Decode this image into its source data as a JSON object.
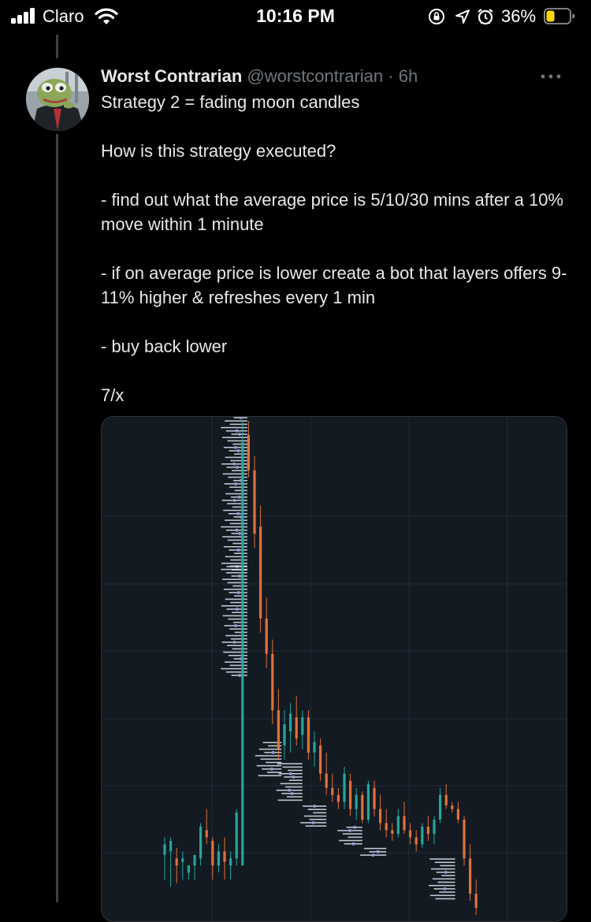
{
  "status_bar": {
    "carrier": "Claro",
    "time": "10:16 PM",
    "battery_percent": "36%",
    "battery_level": 0.36,
    "battery_color": "#ffd60a",
    "icons": [
      "signal-icon",
      "wifi-icon",
      "orientation-lock-icon",
      "location-icon",
      "alarm-icon",
      "battery-icon"
    ]
  },
  "tweet": {
    "author_name": "Worst Contrarian",
    "handle": "@worstcontrarian",
    "separator": "·",
    "time": "6h",
    "avatar_icon": "frog-avatar",
    "more_icon": "more-icon",
    "lines": [
      "Strategy 2 = fading moon candles",
      "How is this strategy executed?",
      "- find out what the average price is 5/10/30 mins after a 10% move within 1 minute",
      "- if on average price is lower create a bot that layers offers 9-11% higher & refreshes every 1 min",
      "- buy back lower",
      "7/x"
    ]
  },
  "chart_data": {
    "type": "candlestick",
    "background": "#131a22",
    "grid": true,
    "up_color": "#26a69a",
    "down_color": "#e0713c",
    "candles": [
      {
        "o": 41.5,
        "h": 44,
        "l": 38,
        "c": 43
      },
      {
        "o": 42,
        "h": 44,
        "l": 37,
        "c": 43.5
      },
      {
        "o": 41,
        "h": 42.5,
        "l": 37.5,
        "c": 40
      },
      {
        "o": 40.5,
        "h": 42,
        "l": 38,
        "c": 41
      },
      {
        "o": 39,
        "h": 40,
        "l": 38,
        "c": 40
      },
      {
        "o": 40,
        "h": 41,
        "l": 38,
        "c": 41.5
      },
      {
        "o": 41,
        "h": 46,
        "l": 40,
        "c": 45.5
      },
      {
        "o": 45,
        "h": 48,
        "l": 43,
        "c": 44
      },
      {
        "o": 43.5,
        "h": 44,
        "l": 38,
        "c": 40
      },
      {
        "o": 40,
        "h": 43,
        "l": 39,
        "c": 42
      },
      {
        "o": 42,
        "h": 44,
        "l": 38,
        "c": 40.5
      },
      {
        "o": 40,
        "h": 42,
        "l": 38,
        "c": 41
      },
      {
        "o": 41,
        "h": 48,
        "l": 40,
        "c": 47.5
      },
      {
        "o": 40,
        "h": 103,
        "l": 40,
        "c": 100
      },
      {
        "o": 101,
        "h": 103,
        "l": 95,
        "c": 96
      },
      {
        "o": 96,
        "h": 98,
        "l": 85,
        "c": 87
      },
      {
        "o": 88,
        "h": 91,
        "l": 73,
        "c": 75
      },
      {
        "o": 75,
        "h": 78,
        "l": 68,
        "c": 70
      },
      {
        "o": 70,
        "h": 72,
        "l": 60,
        "c": 62
      },
      {
        "o": 62,
        "h": 65,
        "l": 55,
        "c": 56.5
      },
      {
        "o": 57,
        "h": 62,
        "l": 55,
        "c": 60
      },
      {
        "o": 59,
        "h": 63,
        "l": 56,
        "c": 61.5
      },
      {
        "o": 61,
        "h": 64,
        "l": 57,
        "c": 58
      },
      {
        "o": 58.5,
        "h": 62,
        "l": 56.5,
        "c": 61
      },
      {
        "o": 61,
        "h": 62,
        "l": 55,
        "c": 56
      },
      {
        "o": 56,
        "h": 59,
        "l": 54,
        "c": 57.5
      },
      {
        "o": 57,
        "h": 58,
        "l": 52,
        "c": 53
      },
      {
        "o": 53,
        "h": 56,
        "l": 50,
        "c": 51
      },
      {
        "o": 51,
        "h": 53,
        "l": 49,
        "c": 50
      },
      {
        "o": 50,
        "h": 51,
        "l": 48,
        "c": 49
      },
      {
        "o": 49,
        "h": 54,
        "l": 48,
        "c": 53
      },
      {
        "o": 52,
        "h": 53,
        "l": 47,
        "c": 48
      },
      {
        "o": 48,
        "h": 51,
        "l": 46.5,
        "c": 50
      },
      {
        "o": 50,
        "h": 50.5,
        "l": 46,
        "c": 46.5
      },
      {
        "o": 46.5,
        "h": 52,
        "l": 46,
        "c": 51.5
      },
      {
        "o": 51,
        "h": 52,
        "l": 47,
        "c": 48
      },
      {
        "o": 48,
        "h": 50,
        "l": 45,
        "c": 46
      },
      {
        "o": 46,
        "h": 48,
        "l": 44,
        "c": 45
      },
      {
        "o": 45,
        "h": 46,
        "l": 43.5,
        "c": 44.5
      },
      {
        "o": 44.5,
        "h": 48,
        "l": 44,
        "c": 47
      },
      {
        "o": 47,
        "h": 49,
        "l": 44.5,
        "c": 45
      },
      {
        "o": 45,
        "h": 46,
        "l": 43,
        "c": 44
      },
      {
        "o": 44,
        "h": 45,
        "l": 42,
        "c": 43
      },
      {
        "o": 43,
        "h": 46,
        "l": 42.5,
        "c": 45.5
      },
      {
        "o": 45.5,
        "h": 47,
        "l": 43.5,
        "c": 44.5
      },
      {
        "o": 44.5,
        "h": 47,
        "l": 43,
        "c": 46.5
      },
      {
        "o": 46.5,
        "h": 51,
        "l": 46,
        "c": 50
      },
      {
        "o": 50,
        "h": 51.5,
        "l": 48,
        "c": 48.5
      },
      {
        "o": 48.5,
        "h": 49,
        "l": 47.5,
        "c": 48
      },
      {
        "o": 48,
        "h": 49,
        "l": 46,
        "c": 46.5
      },
      {
        "o": 46.5,
        "h": 47,
        "l": 40,
        "c": 41
      },
      {
        "o": 41,
        "h": 43,
        "l": 35,
        "c": 36
      },
      {
        "o": 36,
        "h": 38,
        "l": 33,
        "c": 34
      }
    ],
    "order_clusters": [
      {
        "label_y": [
          104,
          81.5
        ],
        "x": 13.8,
        "side": "left"
      },
      {
        "label_y": [
          82.5,
          67
        ],
        "x": 13.8,
        "side": "left"
      },
      {
        "label_y": [
          57.5,
          52.5
        ],
        "x": 19.5,
        "side": "left"
      },
      {
        "label_y": [
          54.5,
          49
        ],
        "x": 23,
        "side": "left"
      },
      {
        "label_y": [
          48.5,
          45.5
        ],
        "x": 27,
        "side": "left"
      },
      {
        "label_y": [
          45.5,
          43
        ],
        "x": 33,
        "side": "left"
      },
      {
        "label_y": [
          42.5,
          41.5
        ],
        "x": 37,
        "side": "left"
      },
      {
        "label_y": [
          41,
          35
        ],
        "x": 48.5,
        "side": "left"
      }
    ],
    "price_range": [
      33,
      104
    ]
  }
}
